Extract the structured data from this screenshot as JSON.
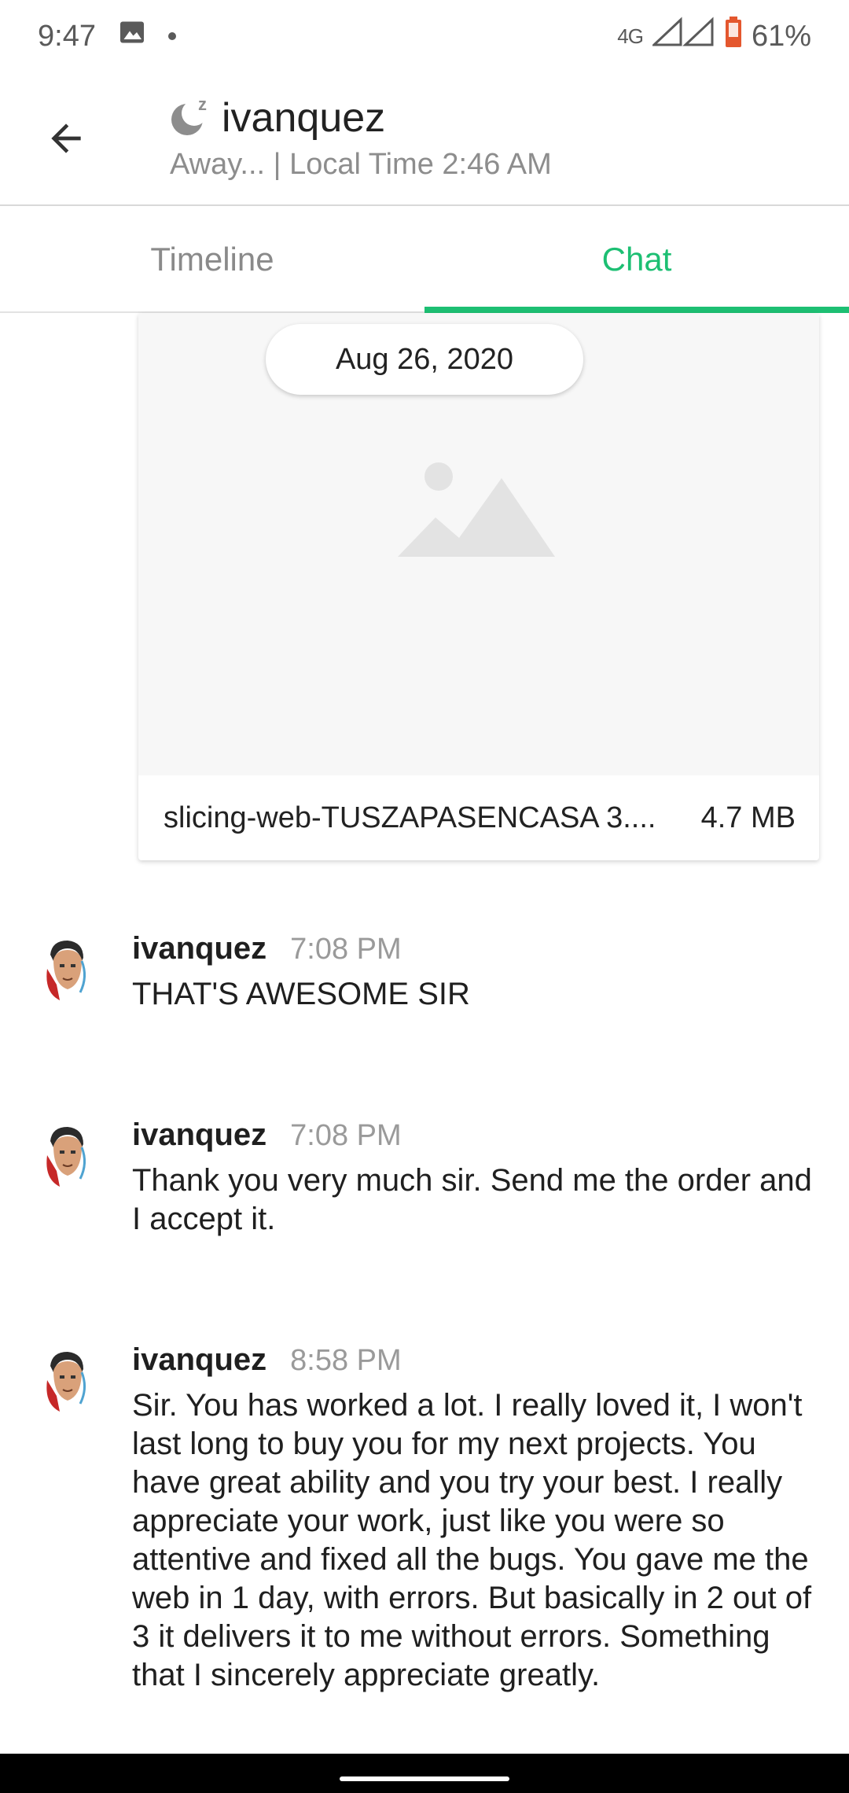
{
  "status_bar": {
    "time": "9:47",
    "network": "4G",
    "battery": "61%",
    "icons": [
      "image-icon",
      "notification-dot",
      "signal-icon",
      "battery-icon"
    ]
  },
  "header": {
    "name": "ivanquez",
    "status_line": "Away... | Local Time 2:46 AM",
    "presence_icon": "moon-sleep-icon"
  },
  "tabs": [
    {
      "label": "Timeline",
      "active": false
    },
    {
      "label": "Chat",
      "active": true
    }
  ],
  "colors": {
    "accent": "#1dbf73",
    "muted_text": "#8d8d8d"
  },
  "attachment": {
    "date": "Aug 26, 2020",
    "filename": "slicing-web-TUSZAPASENCASA 3....",
    "size": "4.7 MB",
    "preview_icon": "image-placeholder-icon"
  },
  "messages": [
    {
      "sender": "ivanquez",
      "time": "7:08 PM",
      "text": "THAT'S AWESOME SIR"
    },
    {
      "sender": "ivanquez",
      "time": "7:08 PM",
      "text": "Thank you very much sir. Send me the order and I accept it."
    },
    {
      "sender": "ivanquez",
      "time": "8:58 PM",
      "text": "Sir. You has worked a lot. I really loved it, I won't last long to buy you for my next projects. You have great ability and you try your best. I really appreciate your work, just like you were so attentive and fixed all the bugs. You gave me the web in 1 day, with errors. But basically in 2 out of 3 it delivers it to me without errors. Something that I sincerely appreciate greatly."
    }
  ]
}
